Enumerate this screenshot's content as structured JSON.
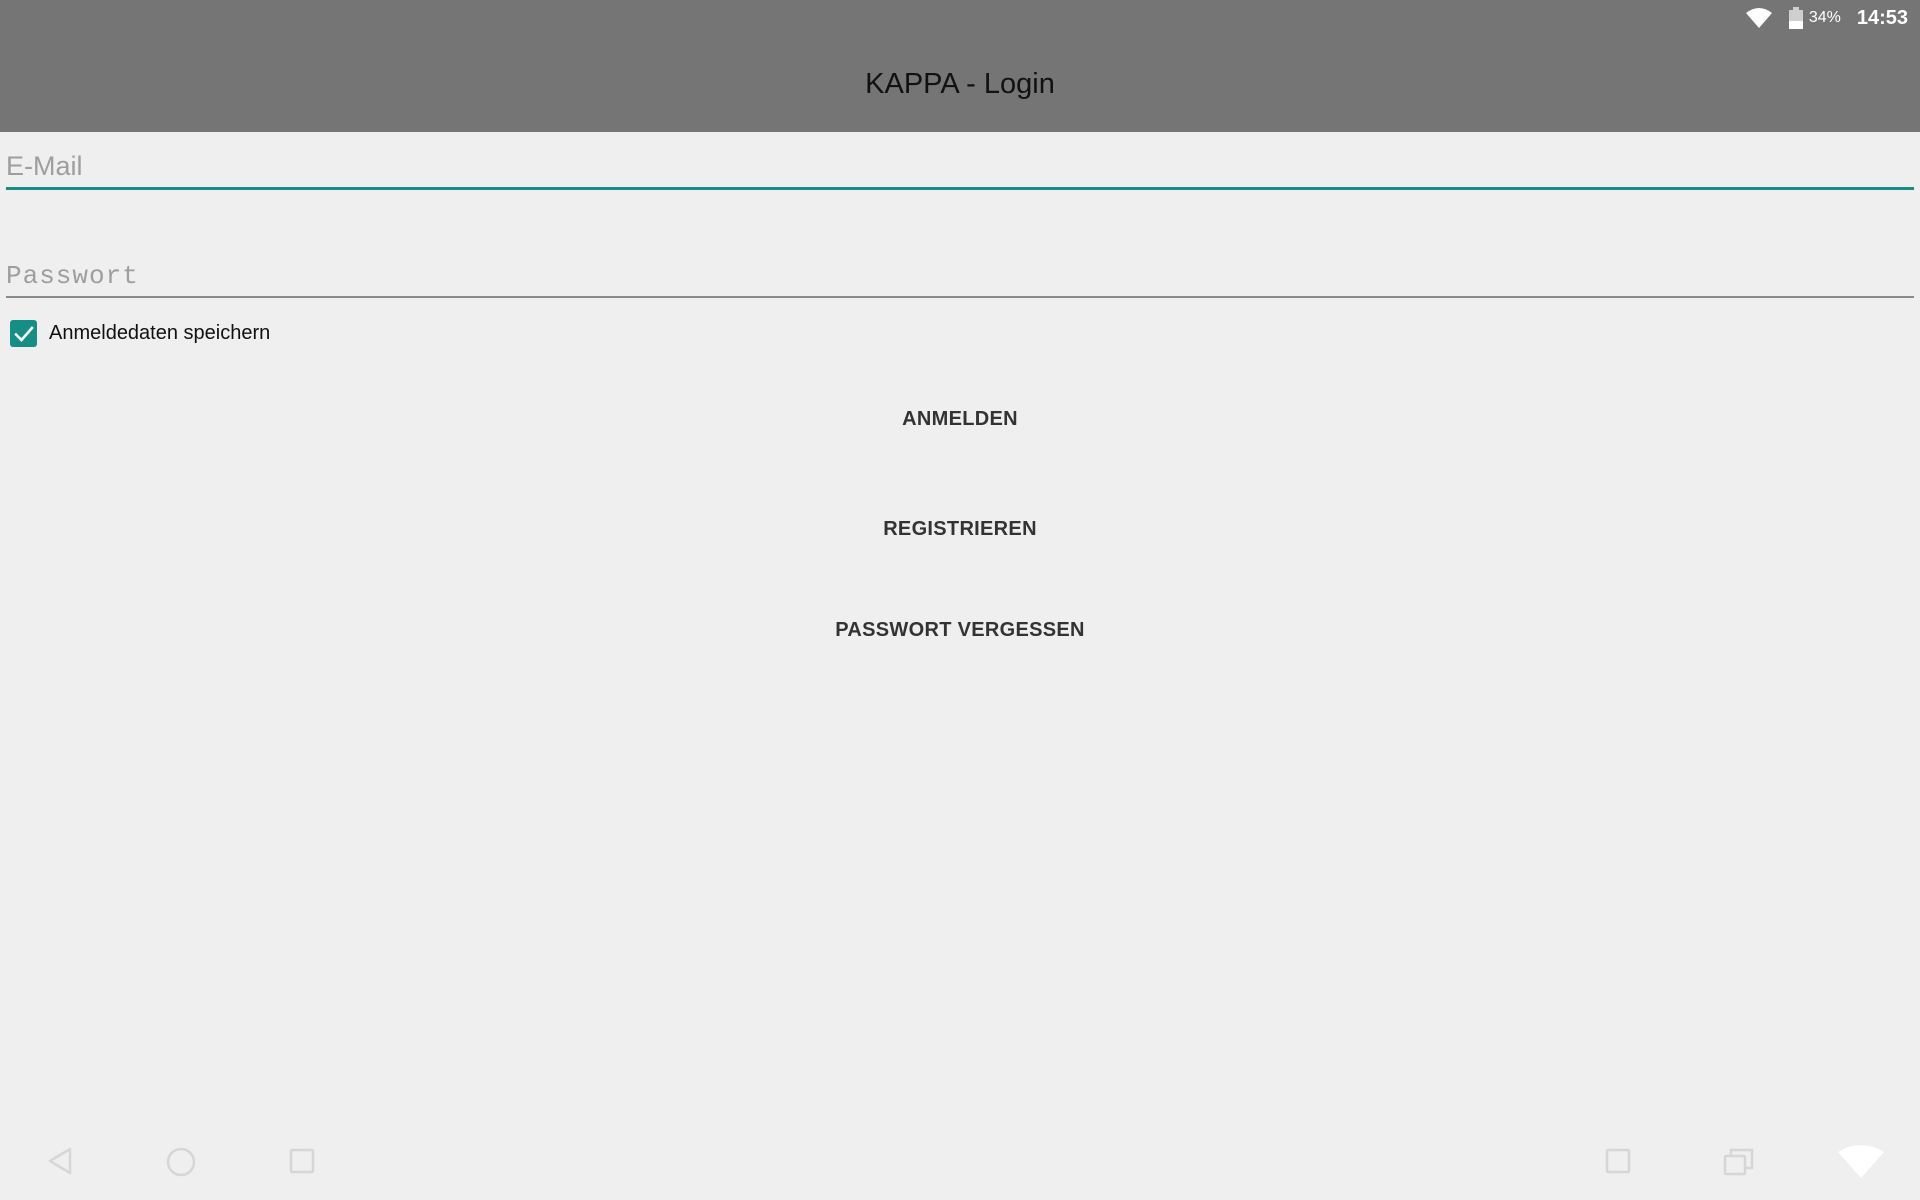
{
  "status_bar": {
    "battery_percent": "34%",
    "time": "14:53",
    "icons": [
      "wifi-icon",
      "battery-icon"
    ]
  },
  "app_bar": {
    "title": "KAPPA - Login"
  },
  "form": {
    "email": {
      "placeholder": "E-Mail",
      "value": ""
    },
    "password": {
      "placeholder": "Passwort",
      "value": ""
    },
    "remember": {
      "label": "Anmeldedaten speichern",
      "checked": true
    }
  },
  "buttons": {
    "login": "ANMELDEN",
    "register": "REGISTRIEREN",
    "forgot": "PASSWORT VERGESSEN"
  },
  "nav_bar": {
    "icons": [
      "back-icon",
      "home-icon",
      "recents-icon",
      "screenshot-icon",
      "multiwindow-icon",
      "wifi-hotspot-icon"
    ]
  },
  "colors": {
    "app_bar": "#757575",
    "accent": "#168e85",
    "background": "#efefef"
  }
}
